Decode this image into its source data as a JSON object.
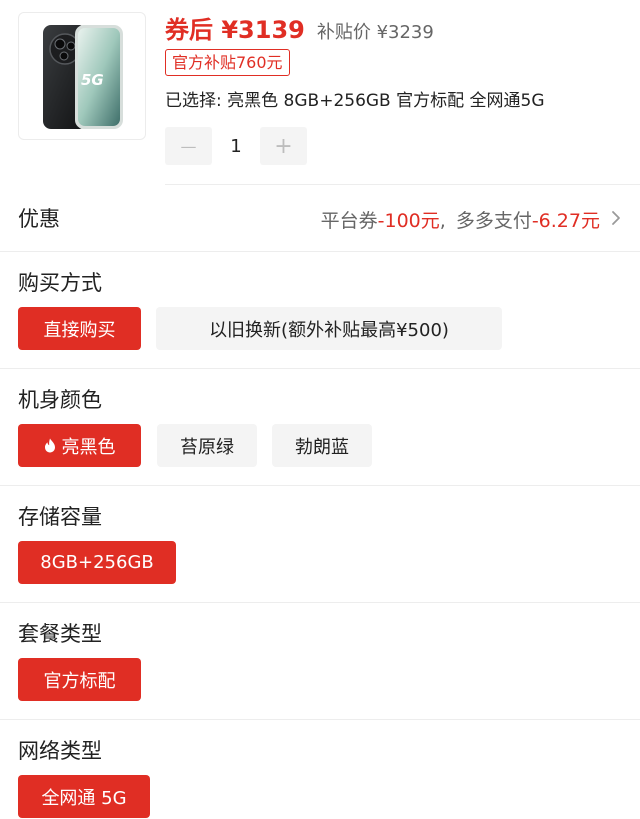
{
  "product": {
    "price_after_coupon": "券后 ¥3139",
    "subsidy_price": "补贴价 ¥3239",
    "subsidy_badge": "官方补贴760元",
    "selected_prefix": "已选择:",
    "selected_value": "亮黑色 8GB+256GB 官方标配 全网通5G",
    "thumbnail_text": "5G",
    "quantity": "1",
    "decrement_symbol": "—",
    "increment_symbol": "+"
  },
  "promo": {
    "label": "优惠",
    "platform_coupon_label": "平台券",
    "platform_coupon_value": "-100元",
    "separator": ",",
    "pay_label": "多多支付",
    "pay_value": "-6.27元"
  },
  "sections": {
    "purchase": {
      "title": "购买方式",
      "options": [
        "直接购买",
        "以旧换新(额外补贴最高¥500)"
      ],
      "selected_index": 0
    },
    "color": {
      "title": "机身颜色",
      "options": [
        "亮黑色",
        "苔原绿",
        "勃朗蓝"
      ],
      "selected_index": 0
    },
    "storage": {
      "title": "存储容量",
      "options": [
        "8GB+256GB"
      ],
      "selected_index": 0
    },
    "package": {
      "title": "套餐类型",
      "options": [
        "官方标配"
      ],
      "selected_index": 0
    },
    "network": {
      "title": "网络类型",
      "options": [
        "全网通 5G"
      ],
      "selected_index": 0
    }
  },
  "colors": {
    "accent": "#e02e24",
    "chip_inactive_bg": "#f4f4f4",
    "divider": "#ededed"
  },
  "icons": {
    "promo_arrow": "chevron-right-icon",
    "hot_color": "flame-icon"
  }
}
